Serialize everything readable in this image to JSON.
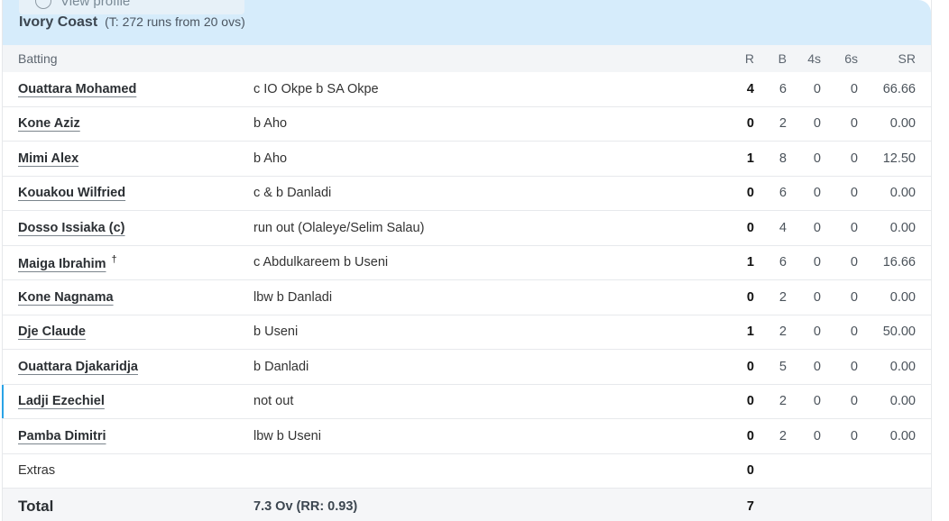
{
  "profile_popup": {
    "label": "View profile",
    "icon": "user-circle-icon"
  },
  "team": {
    "name": "Ivory Coast",
    "target": "(T: 272 runs from 20 ovs)"
  },
  "columns": {
    "batting": "Batting",
    "r": "R",
    "b": "B",
    "fours": "4s",
    "sixes": "6s",
    "sr": "SR"
  },
  "batters": [
    {
      "name": "Ouattara Mohamed",
      "dismissal": "c IO Okpe b SA Okpe",
      "r": "4",
      "b": "6",
      "fours": "0",
      "sixes": "0",
      "sr": "66.66"
    },
    {
      "name": "Kone Aziz",
      "dismissal": "b Aho",
      "r": "0",
      "b": "2",
      "fours": "0",
      "sixes": "0",
      "sr": "0.00"
    },
    {
      "name": "Mimi Alex",
      "dismissal": "b Aho",
      "r": "1",
      "b": "8",
      "fours": "0",
      "sixes": "0",
      "sr": "12.50"
    },
    {
      "name": "Kouakou Wilfried",
      "dismissal": "c & b Danladi",
      "r": "0",
      "b": "6",
      "fours": "0",
      "sixes": "0",
      "sr": "0.00"
    },
    {
      "name": "Dosso Issiaka (c)",
      "dismissal": "run out (Olaleye/Selim Salau)",
      "r": "0",
      "b": "4",
      "fours": "0",
      "sixes": "0",
      "sr": "0.00"
    },
    {
      "name": "Maiga Ibrahim",
      "keeper_mark": "†",
      "dismissal": "c Abdulkareem b Useni",
      "r": "1",
      "b": "6",
      "fours": "0",
      "sixes": "0",
      "sr": "16.66"
    },
    {
      "name": "Kone Nagnama",
      "dismissal": "lbw b Danladi",
      "r": "0",
      "b": "2",
      "fours": "0",
      "sixes": "0",
      "sr": "0.00"
    },
    {
      "name": "Dje Claude",
      "dismissal": "b Useni",
      "r": "1",
      "b": "2",
      "fours": "0",
      "sixes": "0",
      "sr": "50.00"
    },
    {
      "name": "Ouattara Djakaridja",
      "dismissal": "b Danladi",
      "r": "0",
      "b": "5",
      "fours": "0",
      "sixes": "0",
      "sr": "0.00"
    },
    {
      "name": "Ladji Ezechiel",
      "dismissal": "not out",
      "r": "0",
      "b": "2",
      "fours": "0",
      "sixes": "0",
      "sr": "0.00"
    },
    {
      "name": "Pamba Dimitri",
      "dismissal": "lbw b Useni",
      "r": "0",
      "b": "2",
      "fours": "0",
      "sixes": "0",
      "sr": "0.00"
    }
  ],
  "extras": {
    "label": "Extras",
    "value": "0"
  },
  "total": {
    "label": "Total",
    "overs": "7.3 Ov (RR: 0.93)",
    "value": "7"
  },
  "colors": {
    "header_bg": "#d6ecfb",
    "active_indicator": "#2aa3e6"
  }
}
